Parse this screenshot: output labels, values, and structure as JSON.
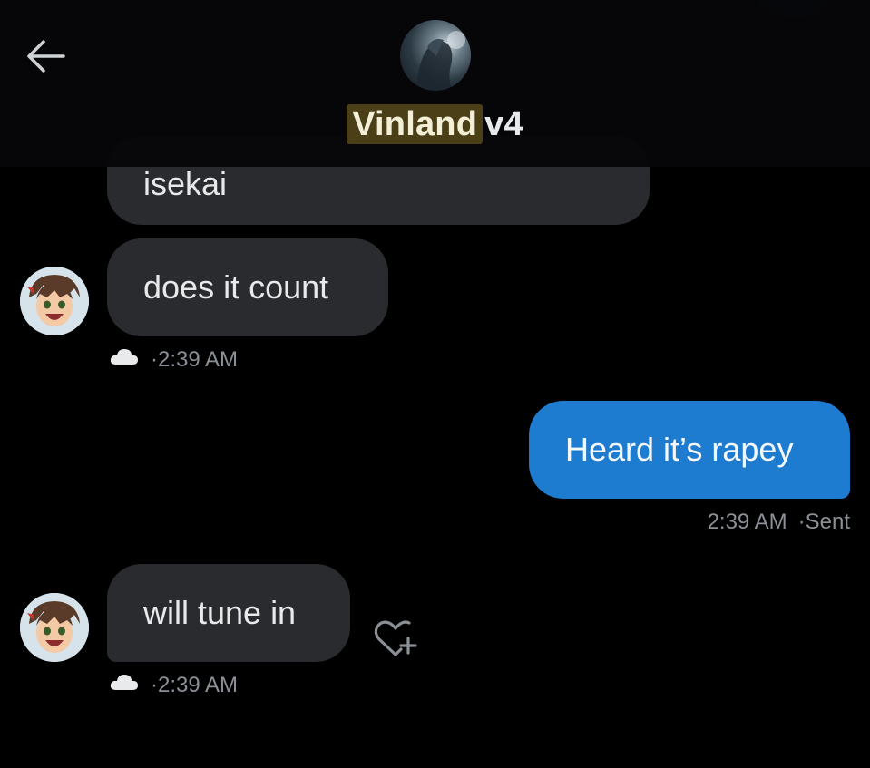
{
  "header": {
    "title_highlighted": "Vinland",
    "title_rest": "v4",
    "avatar_icon": "group-avatar-icon",
    "back_icon": "back-arrow-icon"
  },
  "colors": {
    "background": "#000000",
    "incoming_bubble": "#2a2b2e",
    "outgoing_bubble": "#1d7bd0",
    "meta_text": "#8b9096",
    "title_highlight": "#4a3f16"
  },
  "messages": [
    {
      "direction": "incoming",
      "text": "isekai",
      "partial": true
    },
    {
      "direction": "incoming",
      "text": "does it count",
      "meta_icon": "cloud-icon",
      "time": "·2:39 AM"
    },
    {
      "direction": "outgoing",
      "text": "Heard it’s rapey",
      "time": "2:39 AM",
      "status": "·Sent"
    },
    {
      "direction": "incoming",
      "text": "will tune in",
      "meta_icon": "cloud-icon",
      "time": "·2:39 AM",
      "reaction_icon": "add-reaction-icon"
    }
  ]
}
